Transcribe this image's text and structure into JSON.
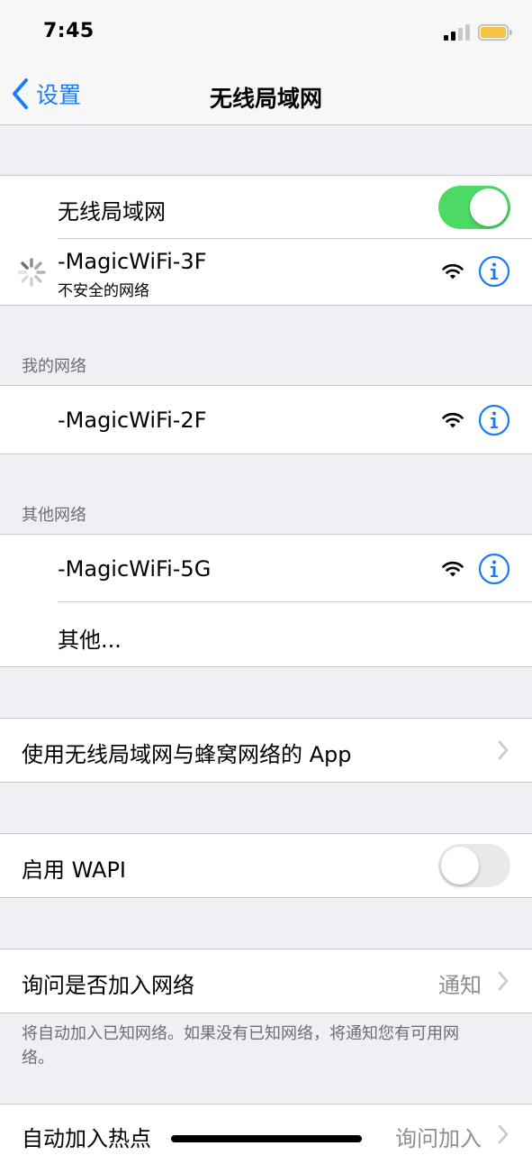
{
  "status_bar": {
    "time": "7:45"
  },
  "nav": {
    "back_label": "设置",
    "title": "无线局域网"
  },
  "wifi": {
    "toggle_label": "无线局域网",
    "toggle_on": true,
    "current_network": {
      "name": "-MagicWiFi-3F",
      "subtitle": "不安全的网络"
    }
  },
  "my_networks": {
    "header": "我的网络",
    "items": [
      {
        "name": "-MagicWiFi-2F"
      }
    ]
  },
  "other_networks": {
    "header": "其他网络",
    "items": [
      {
        "name": "-MagicWiFi-5G"
      }
    ],
    "other_label": "其他..."
  },
  "apps_row": {
    "label": "使用无线局域网与蜂窝网络的 App"
  },
  "wapi": {
    "label": "启用 WAPI",
    "toggle_on": false
  },
  "ask_join": {
    "label": "询问是否加入网络",
    "value": "通知",
    "footer": "将自动加入已知网络。如果没有已知网络，将通知您有可用网络。"
  },
  "auto_hotspot": {
    "label": "自动加入热点",
    "value": "询问加入"
  },
  "colors": {
    "accent": "#1a7cf5",
    "toggle_on": "#4cd964",
    "battery": "#f5c542",
    "background": "#efeff4"
  }
}
